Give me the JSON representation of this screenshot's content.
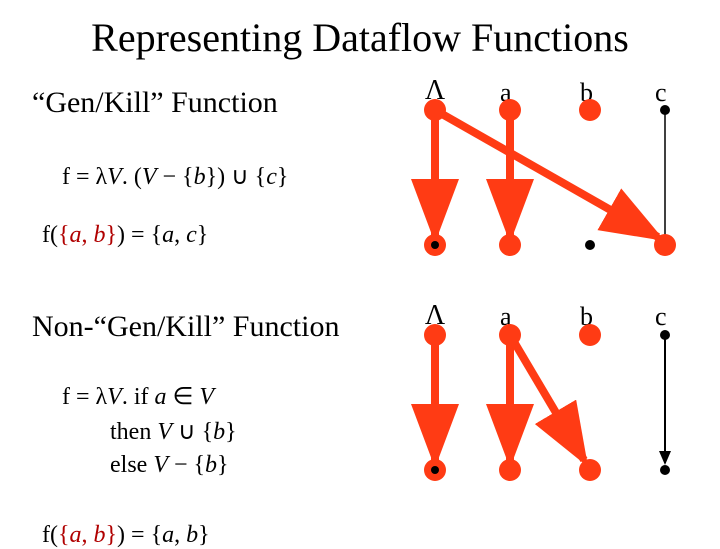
{
  "title": "Representing Dataflow Functions",
  "section1": "“Gen/Kill” Function",
  "section2": "Non-“Gen/Kill” Function",
  "eq1_lhs": "f = λ",
  "eq1_V": "V",
  "eq1_mid1": ". (",
  "eq1_V2": "V",
  "eq1_mid2": " − {",
  "eq1_b": "b",
  "eq1_mid3": "}) ∪ {",
  "eq1_c": "c",
  "eq1_end": "}",
  "eq2_lhs": "f(",
  "eq2_set": "{",
  "eq2_a": "a",
  "eq2_com": ", ",
  "eq2_b": "b",
  "eq2_close": "}",
  "eq2_rhs": ") = {",
  "eq2_ra": "a",
  "eq2_rc": "c",
  "eq2_end": "}",
  "eq3_lhs": "f = λ",
  "eq3_V": "V",
  "eq3_dot": ". if ",
  "eq3_a": "a",
  "eq3_in": " ∈ ",
  "eq3_V2": "V",
  "eq4_then": "        then ",
  "eq4_V": "V",
  "eq4_cup": " ∪ {",
  "eq4_b": "b",
  "eq4_end": "}",
  "eq5_else": "        else ",
  "eq5_V": "V",
  "eq5_min": " − {",
  "eq5_b": "b",
  "eq5_end": "}",
  "eq6_lhs": "f(",
  "eq6_set": "{",
  "eq6_a": "a",
  "eq6_com": ", ",
  "eq6_b": "b",
  "eq6_close": "}",
  "eq6_rhs": ") = {",
  "eq6_ra": "a",
  "eq6_rb": "b",
  "eq6_end": "}",
  "columns": {
    "a": "a",
    "b": "b",
    "c": "c"
  },
  "chart_data": [
    {
      "type": "bipartite",
      "title": "Gen/Kill Function graph",
      "nodes_top": [
        "Λ",
        "a",
        "b",
        "c"
      ],
      "nodes_bottom": [
        "Λ",
        "a",
        "b",
        "c"
      ],
      "edges": [
        {
          "from": "Λ",
          "to": "Λ",
          "style": "highlight"
        },
        {
          "from": "a",
          "to": "a",
          "style": "highlight"
        },
        {
          "from": "b",
          "to": "b",
          "style": "absent"
        },
        {
          "from": "Λ",
          "to": "c",
          "style": "highlight"
        },
        {
          "from": "c",
          "to": "c",
          "style": "normal"
        }
      ]
    },
    {
      "type": "bipartite",
      "title": "Non-Gen/Kill Function graph",
      "nodes_top": [
        "Λ",
        "a",
        "b",
        "c"
      ],
      "nodes_bottom": [
        "Λ",
        "a",
        "b",
        "c"
      ],
      "edges": [
        {
          "from": "Λ",
          "to": "Λ",
          "style": "highlight"
        },
        {
          "from": "a",
          "to": "a",
          "style": "highlight"
        },
        {
          "from": "a",
          "to": "b",
          "style": "highlight"
        },
        {
          "from": "c",
          "to": "c",
          "style": "normal"
        }
      ]
    }
  ]
}
